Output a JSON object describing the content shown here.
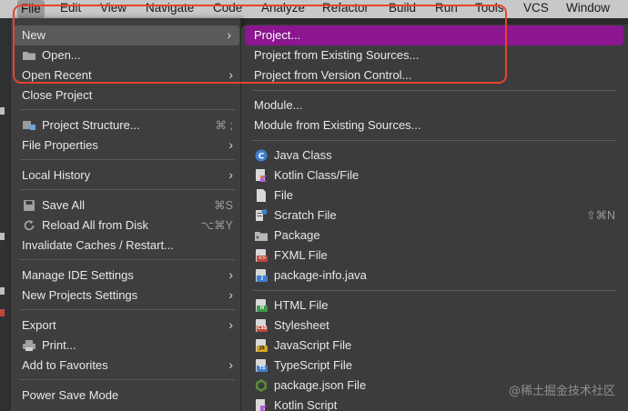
{
  "menubar": {
    "items": [
      "File",
      "Edit",
      "View",
      "Navigate",
      "Code",
      "Analyze",
      "Refactor",
      "Build",
      "Run",
      "Tools",
      "VCS",
      "Window"
    ]
  },
  "file_menu": {
    "items": {
      "new": {
        "label": "New"
      },
      "open": {
        "label": "Open..."
      },
      "open_recent": {
        "label": "Open Recent"
      },
      "close_project": {
        "label": "Close Project"
      },
      "project_structure": {
        "label": "Project Structure...",
        "shortcut": "⌘ ;"
      },
      "file_properties": {
        "label": "File Properties"
      },
      "local_history": {
        "label": "Local History"
      },
      "save_all": {
        "label": "Save All",
        "shortcut": "⌘S"
      },
      "reload_all": {
        "label": "Reload All from Disk",
        "shortcut": "⌥⌘Y"
      },
      "invalidate_caches": {
        "label": "Invalidate Caches / Restart..."
      },
      "manage_ide_settings": {
        "label": "Manage IDE Settings"
      },
      "new_projects_settings": {
        "label": "New Projects Settings"
      },
      "export": {
        "label": "Export"
      },
      "print": {
        "label": "Print..."
      },
      "add_to_favorites": {
        "label": "Add to Favorites"
      },
      "power_save_mode": {
        "label": "Power Save Mode"
      }
    }
  },
  "new_submenu": {
    "items": {
      "project": {
        "label": "Project..."
      },
      "project_existing": {
        "label": "Project from Existing Sources..."
      },
      "project_vcs": {
        "label": "Project from Version Control..."
      },
      "module": {
        "label": "Module..."
      },
      "module_existing": {
        "label": "Module from Existing Sources..."
      },
      "java_class": {
        "label": "Java Class"
      },
      "kotlin_class": {
        "label": "Kotlin Class/File"
      },
      "file": {
        "label": "File"
      },
      "scratch_file": {
        "label": "Scratch File",
        "shortcut": "⇧⌘N"
      },
      "package": {
        "label": "Package"
      },
      "fxml_file": {
        "label": "FXML File"
      },
      "package_info": {
        "label": "package-info.java"
      },
      "html_file": {
        "label": "HTML File"
      },
      "stylesheet": {
        "label": "Stylesheet"
      },
      "javascript_file": {
        "label": "JavaScript File"
      },
      "typescript_file": {
        "label": "TypeScript File"
      },
      "package_json": {
        "label": "package.json File"
      },
      "kotlin_script": {
        "label": "Kotlin Script"
      }
    }
  },
  "badges": {
    "fxml": "<>",
    "java": "J",
    "html": "H",
    "css": "CSS",
    "js": "JS",
    "ts": "TS"
  },
  "watermark": "@稀土掘金技术社区",
  "colors": {
    "selection": "#8b168f",
    "annotation_box": "#e8432e",
    "menu_bg": "#3e3e40"
  }
}
